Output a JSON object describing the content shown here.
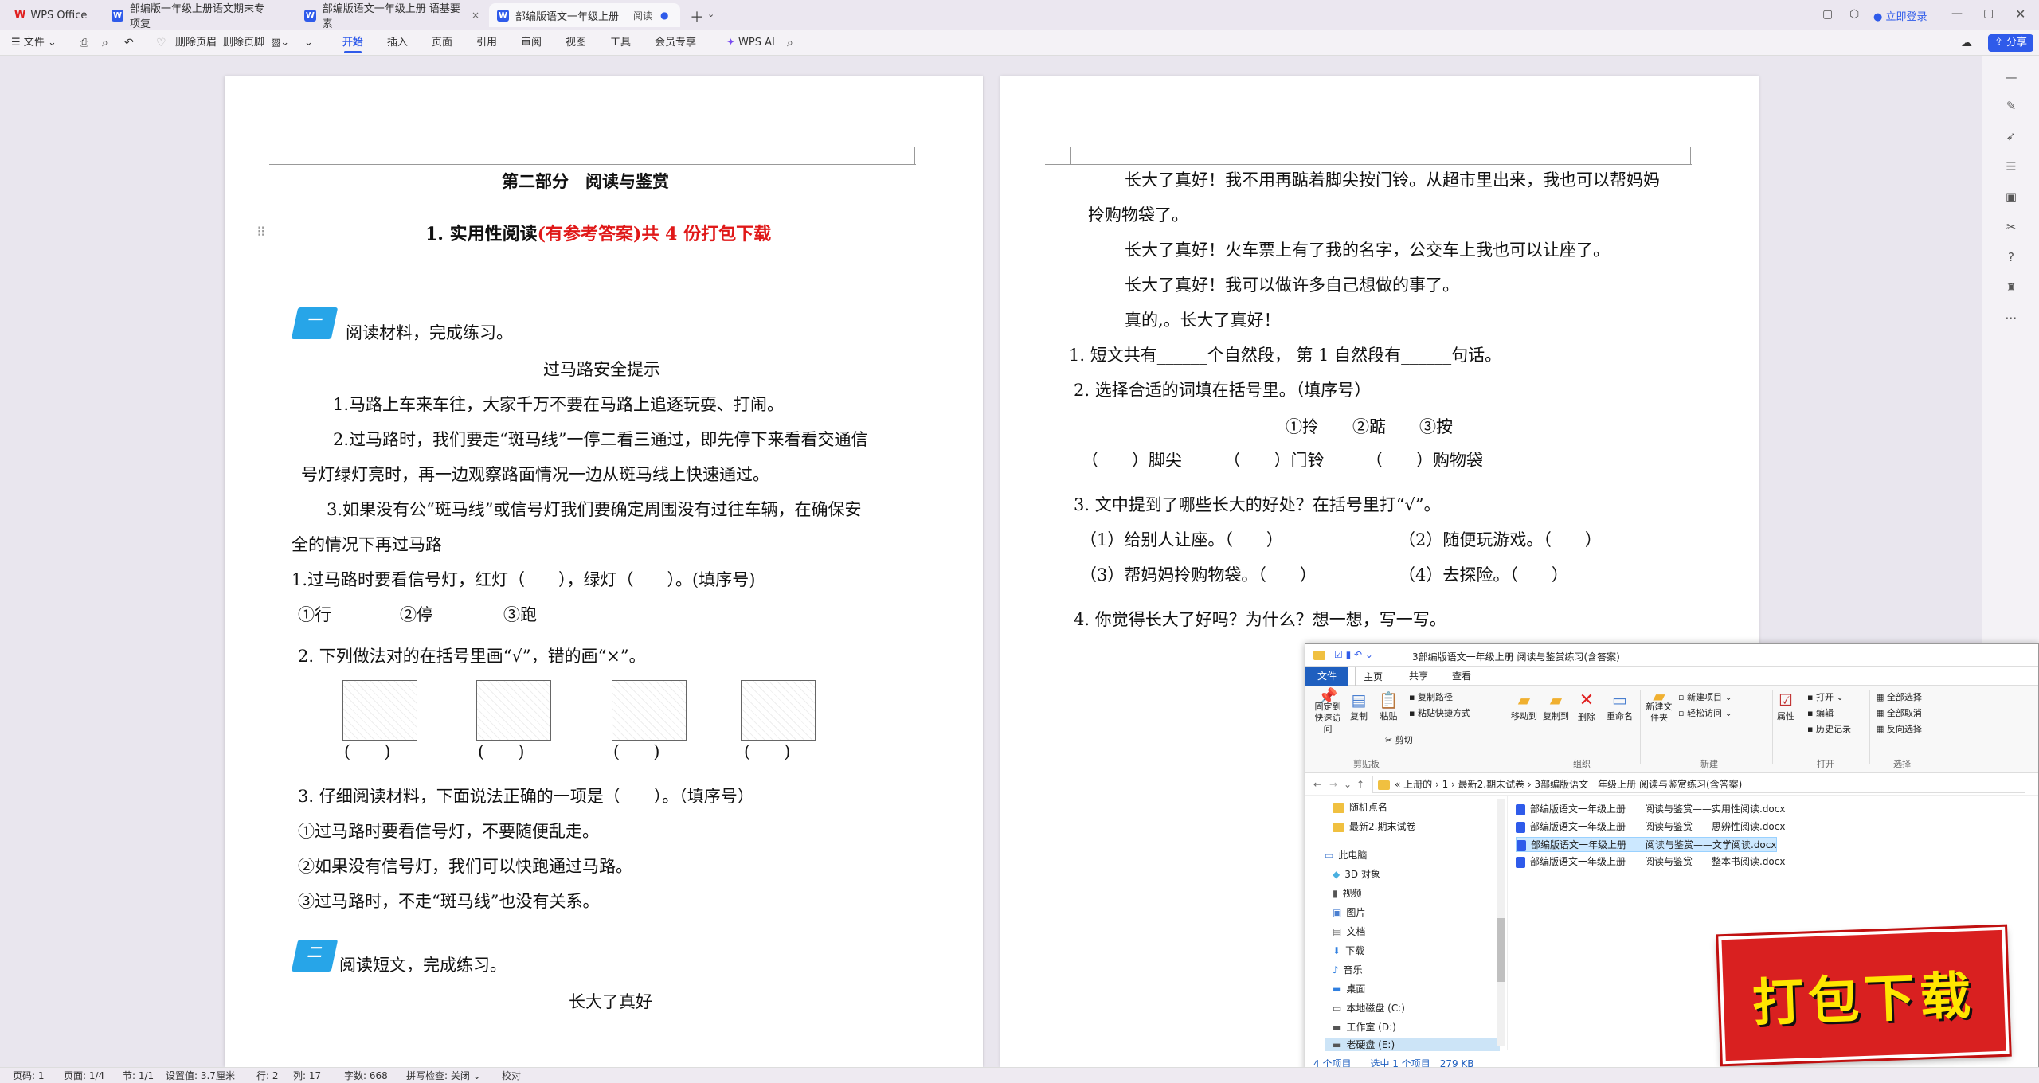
{
  "tabs": [
    {
      "label": "WPS Office"
    },
    {
      "label": "部编版一年级上册语文期末专项复"
    },
    {
      "label": "部编版语文一年级上册 语基要素"
    },
    {
      "label": "部编版语文一年级上册",
      "mode": "阅读"
    }
  ],
  "topright": {
    "login": "立即登录"
  },
  "ribbon": {
    "file": "文件",
    "tabs": [
      "开始",
      "插入",
      "页面",
      "引用",
      "审阅",
      "视图",
      "工具",
      "会员专享"
    ],
    "ai": "WPS AI",
    "share": "分享",
    "tools": [
      "删除页眉",
      "删除页脚"
    ]
  },
  "page1": {
    "part_title": "第二部分　阅读与鉴赏",
    "heading_black": "1. 实用性阅读",
    "heading_red": "(有参考答案)共 4 份打包下载",
    "badge1": "一",
    "instr1": "阅读材料，完成练习。",
    "article_title": "过马路安全提示",
    "lines": [
      "1.马路上车来车往，大家千万不要在马路上追逐玩耍、打闹。",
      "2.过马路时，我们要走“斑马线”一停二看三通过，即先停下来看看交通信",
      "号灯绿灯亮时，再一边观察路面情况一边从斑马线上快速通过。",
      "3.如果没有公“斑马线”或信号灯我们要确定周围没有过往车辆，在确保安",
      "全的情况下再过马路"
    ],
    "q1": "1.过马路时要看信号灯，红灯（　　），绿灯（　　）。(填序号)",
    "q1_options": [
      "①行",
      "②停",
      "③跑"
    ],
    "q2": "2.  下列做法对的在括号里画“√”，错的画“×”。",
    "q2_brackets": "(　　)",
    "q3": "3.  仔细阅读材料，下面说法正确的一项是（　　）。（填序号）",
    "q3_options": [
      "①过马路时要看信号灯，不要随便乱走。",
      "②如果没有信号灯，我们可以快跑通过马路。",
      "③过马路时，不走“斑马线”也没有关系。"
    ],
    "badge2": "二",
    "instr2": "阅读短文，完成练习。",
    "story_title": "长大了真好"
  },
  "page2": {
    "lines": [
      "长大了真好！我不用再踮着脚尖按门铃。从超市里出来，我也可以帮妈妈",
      "拎购物袋了。",
      "长大了真好！火车票上有了我的名字，公交车上我也可以让座了。",
      "长大了真好！我可以做许多自己想做的事了。",
      "真的,。长大了真好！"
    ],
    "q1": "1.  短文共有______个自然段， 第 1 自然段有______句话。",
    "q2": "2.  选择合适的词填在括号里。（填序号）",
    "q2_options": "①拎　　②踮　　③按",
    "q2_blanks": "（　　）脚尖　　　（　　）门铃　　　（　　）购物袋",
    "q3": "3.  文中提到了哪些长大的好处？在括号里打“√”。",
    "q3_a": "（1）给别人让座。（　　）",
    "q3_b": "（2）随便玩游戏。（　　）",
    "q3_c": "（3）帮妈妈拎购物袋。（　　）",
    "q3_d": "（4）去探险。（　　）",
    "q4": "4.  你觉得长大了好吗？为什么？想一想，写一写。"
  },
  "explorer": {
    "title": "3部编版语文一年级上册 阅读与鉴赏练习(含答案)",
    "ribbon_tabs": [
      "文件",
      "主页",
      "共享",
      "查看"
    ],
    "groups": [
      "剪贴板",
      "组织",
      "新建",
      "打开",
      "选择"
    ],
    "buttons": [
      "固定到快速访问",
      "复制",
      "粘贴",
      "复制路径",
      "粘贴快捷方式",
      "剪切",
      "移动到",
      "复制到",
      "删除",
      "重命名",
      "新建文件夹",
      "新建项目",
      "轻松访问",
      "属性",
      "打开",
      "编辑",
      "历史记录",
      "全部选择",
      "全部取消",
      "反向选择"
    ],
    "path": "« 上册的 › 1 › 最新2.期末试卷 › 3部编版语文一年级上册 阅读与鉴赏练习(含答案)",
    "nav": [
      "随机点名",
      "最新2.期末试卷",
      "此电脑",
      "3D 对象",
      "视频",
      "图片",
      "文档",
      "下载",
      "音乐",
      "桌面",
      "本地磁盘 (C:)",
      "工作室 (D:)",
      "老硬盘 (E:)"
    ],
    "files": [
      "部编版语文一年级上册　　阅读与鉴赏——实用性阅读.docx",
      "部编版语文一年级上册　　阅读与鉴赏——思辨性阅读.docx",
      "部编版语文一年级上册　　阅读与鉴赏——文学阅读.docx",
      "部编版语文一年级上册　　阅读与鉴赏——整本书阅读.docx"
    ],
    "status": "4 个项目　　选中 1 个项目　279 KB"
  },
  "banner": "打包下载",
  "status": {
    "page": "页码: 1",
    "pages": "页面: 1/4",
    "section": "节: 1/1",
    "setting": "设置值: 3.7厘米",
    "row": "行: 2",
    "col": "列: 17",
    "words": "字数: 668",
    "spell": "拼写检查: 关闭",
    "proof": "校对"
  }
}
